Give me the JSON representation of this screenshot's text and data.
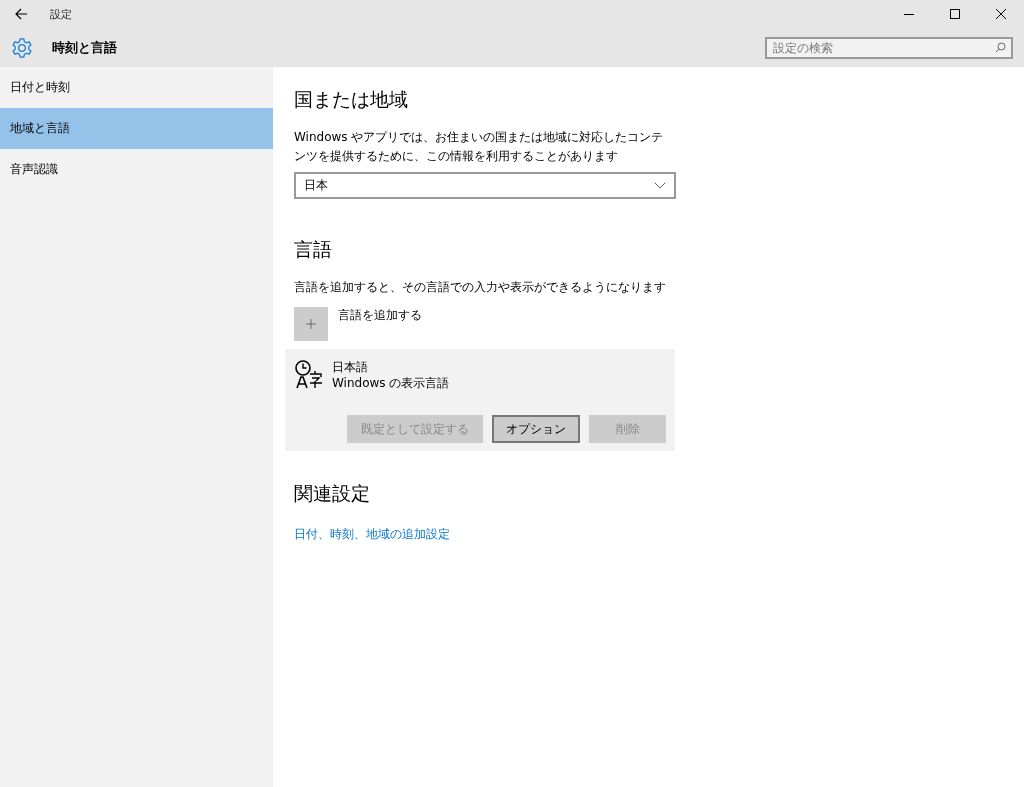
{
  "window": {
    "title": "設定"
  },
  "header": {
    "title": "時刻と言語",
    "search": {
      "placeholder": "設定の検索"
    }
  },
  "sidebar": {
    "items": [
      {
        "label": "日付と時刻",
        "selected": false
      },
      {
        "label": "地域と言語",
        "selected": true
      },
      {
        "label": "音声認識",
        "selected": false
      }
    ]
  },
  "region": {
    "heading": "国または地域",
    "description": "Windows やアプリでは、お住まいの国または地域に対応したコンテンツを提供するために、この情報を利用することがあります",
    "dropdown": {
      "value": "日本"
    }
  },
  "language": {
    "heading": "言語",
    "description": "言語を追加すると、その言語での入力や表示ができるようになります",
    "add_button": {
      "label": "言語を追加する"
    },
    "languages": [
      {
        "name": "日本語",
        "subtitle": "Windows の表示言語",
        "selected": true,
        "buttons": [
          {
            "label": "既定として設定する",
            "disabled": true
          },
          {
            "label": "オプション",
            "disabled": false
          },
          {
            "label": "削除",
            "disabled": true
          }
        ]
      }
    ]
  },
  "related": {
    "heading": "関連設定",
    "links": [
      "日付、時刻、地域の追加設定"
    ]
  }
}
